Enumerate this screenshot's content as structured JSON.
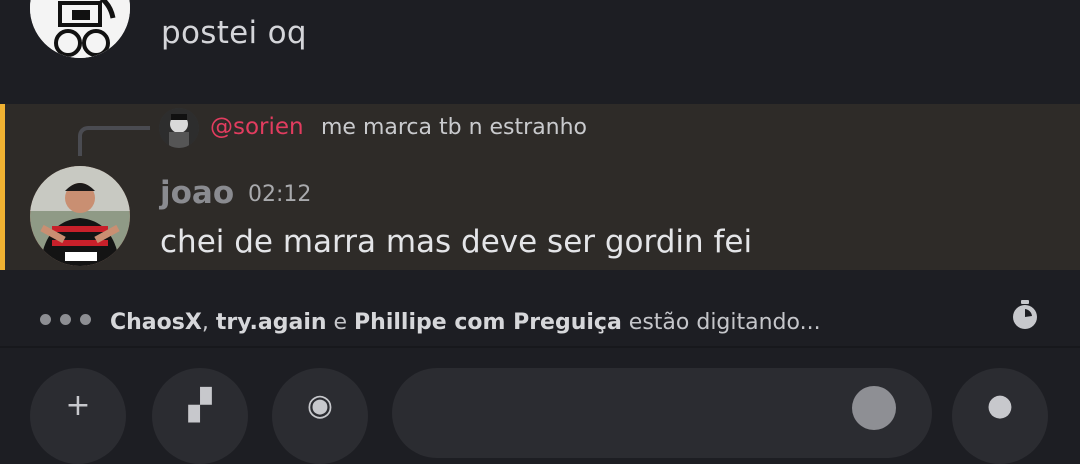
{
  "previous_message": {
    "text": "postei oq"
  },
  "mention_message": {
    "reply": {
      "mention": "@sorien",
      "text": "me marca tb n estranho"
    },
    "author": "joao",
    "timestamp": "02:12",
    "text": "chei de marra mas deve ser gordin fei"
  },
  "typing": {
    "user1": "ChaosX",
    "sep1": ", ",
    "user2": "try.again",
    "sep2": " e ",
    "user3": "Phillipe com Preguiça",
    "suffix": " estão digitando..."
  },
  "colors": {
    "background": "#1d1e23",
    "mention_highlight": "#2e2b28",
    "mention_bar": "#f0b232",
    "mention_text": "#e23c5f"
  },
  "icons": {
    "typing": "typing-dots-icon",
    "slowmode": "timer-icon",
    "add": "plus-icon",
    "gift": "gift-icon",
    "apps": "apps-icon",
    "emoji": "emoji-icon",
    "mic": "microphone-icon"
  }
}
